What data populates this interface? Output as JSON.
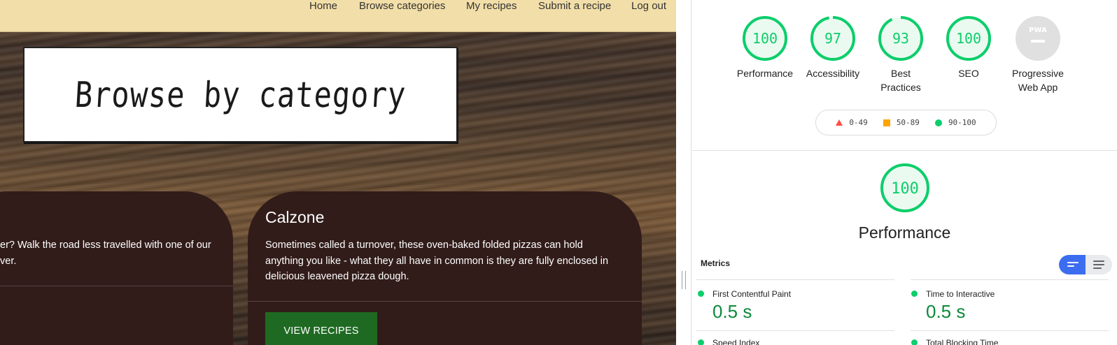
{
  "site": {
    "nav": [
      "Home",
      "Browse categories",
      "My recipes",
      "Submit a recipe",
      "Log out"
    ],
    "page_title": "Browse by category",
    "cards": [
      {
        "title": "",
        "description_lines": [
          "er? Walk the road less travelled with one of our",
          "ver."
        ]
      },
      {
        "title": "Calzone",
        "description_lines": [
          "Sometimes called a turnover, these oven-baked folded pizzas can hold",
          "anything you like - what they all have in common is they are fully enclosed in",
          "delicious leavened pizza dough."
        ],
        "button_label": "VIEW RECIPES"
      }
    ]
  },
  "lighthouse": {
    "gauges": [
      {
        "score": "100",
        "score_fraction": 1.0,
        "label_lines": [
          "Performance"
        ]
      },
      {
        "score": "97",
        "score_fraction": 0.97,
        "label_lines": [
          "Accessibility"
        ]
      },
      {
        "score": "93",
        "score_fraction": 0.93,
        "label_lines": [
          "Best",
          "Practices"
        ]
      },
      {
        "score": "100",
        "score_fraction": 1.0,
        "label_lines": [
          "SEO"
        ]
      },
      {
        "score": "",
        "badge": "PWA",
        "label_lines": [
          "Progressive",
          "Web App"
        ]
      }
    ],
    "legend": [
      {
        "shape": "triangle",
        "range": "0-49",
        "color": "#ff4e42"
      },
      {
        "shape": "square",
        "range": "50-89",
        "color": "#ffa400"
      },
      {
        "shape": "circle",
        "range": "90-100",
        "color": "#0cce6b"
      }
    ],
    "main_gauge": {
      "score": "100",
      "score_fraction": 1.0,
      "label": "Performance"
    },
    "metrics_heading": "Metrics",
    "metrics": [
      {
        "name": "First Contentful Paint",
        "value": "0.5 s"
      },
      {
        "name": "Time to Interactive",
        "value": "0.5 s"
      },
      {
        "name": "Speed Index",
        "value": ""
      },
      {
        "name": "Total Blocking Time",
        "value": ""
      }
    ],
    "colors": {
      "pass": "#0cce6b",
      "pass_text": "#0b8a3a",
      "toggle_active": "#3c6df0"
    }
  }
}
